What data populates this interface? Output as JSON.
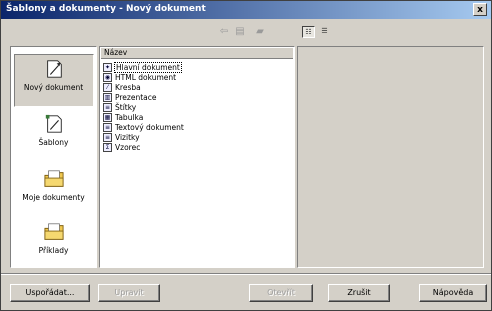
{
  "window": {
    "title": "Šablony a dokumenty - Nový dokument",
    "close_label": "x"
  },
  "toolbar": {
    "icons": [
      "arrow-left-icon",
      "folder-up-icon",
      "printer-icon"
    ],
    "view_icons": [
      "details-view-icon",
      "list-view-icon"
    ]
  },
  "categories": [
    {
      "label": "Nový dokument",
      "icon": "new-document-icon",
      "selected": true
    },
    {
      "label": "Šablony",
      "icon": "templates-icon",
      "selected": false
    },
    {
      "label": "Moje dokumenty",
      "icon": "my-documents-folder-icon",
      "selected": false
    },
    {
      "label": "Příklady",
      "icon": "examples-folder-icon",
      "selected": false
    }
  ],
  "list": {
    "header": "Název",
    "items": [
      {
        "label": "Hlavní dokument",
        "icon": "master-document-icon",
        "focused": true
      },
      {
        "label": "HTML dokument",
        "icon": "html-document-icon",
        "focused": false
      },
      {
        "label": "Kresba",
        "icon": "drawing-icon",
        "focused": false
      },
      {
        "label": "Prezentace",
        "icon": "presentation-icon",
        "focused": false
      },
      {
        "label": "Štítky",
        "icon": "labels-icon",
        "focused": false
      },
      {
        "label": "Tabulka",
        "icon": "spreadsheet-icon",
        "focused": false
      },
      {
        "label": "Textový dokument",
        "icon": "text-document-icon",
        "focused": false
      },
      {
        "label": "Vizitky",
        "icon": "business-cards-icon",
        "focused": false
      },
      {
        "label": "Vzorec",
        "icon": "formula-icon",
        "focused": false
      }
    ]
  },
  "buttons": {
    "organize": "Uspořádat...",
    "edit": "Upravit",
    "open": "Otevřít",
    "cancel": "Zrušit",
    "help": "Nápověda"
  }
}
